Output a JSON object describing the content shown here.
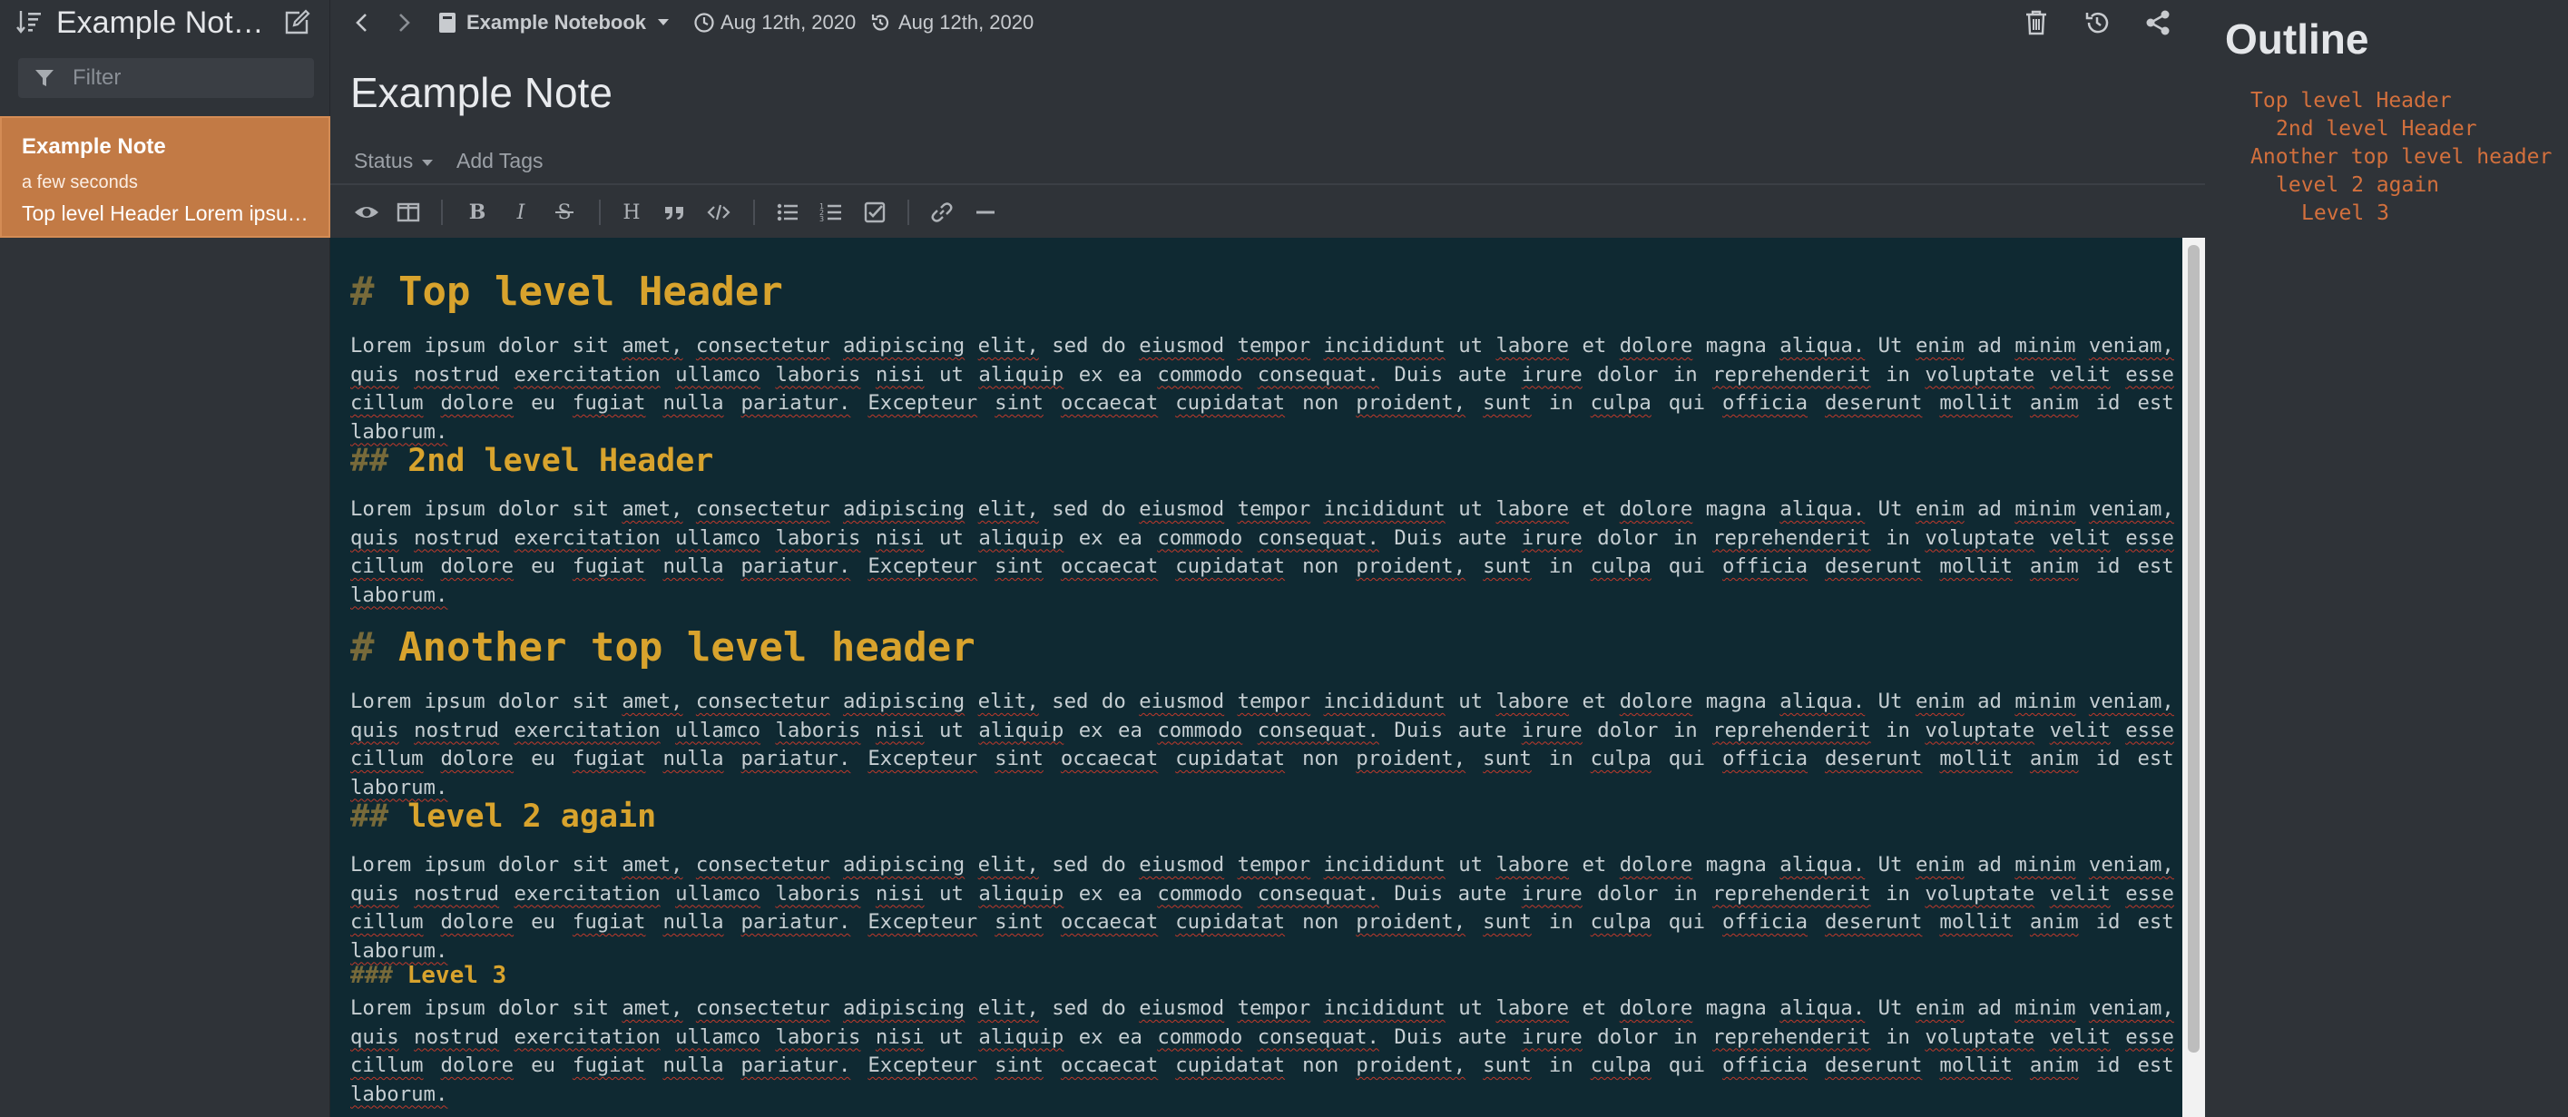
{
  "colors": {
    "background": "#2f3338",
    "editor_bg": "#0f2932",
    "accent_selected": "#c27a45",
    "heading": "#d8a32d",
    "outline_link": "#d3703d"
  },
  "sidebar": {
    "title": "Example Notebook",
    "sort_icon": "sort-icon",
    "new_note_icon": "edit-icon",
    "filter_placeholder": "Filter",
    "notes": [
      {
        "title": "Example Note",
        "time": "a few seconds",
        "preview": "Top level Header Lorem ipsum dolor sit amet"
      }
    ]
  },
  "topbar": {
    "notebook": "Example Notebook",
    "created": "Aug 12th, 2020",
    "modified": "Aug 12th, 2020",
    "icons": [
      "back-icon",
      "forward-icon",
      "notebook-icon",
      "clock-icon",
      "history-icon",
      "trash-icon",
      "restore-icon",
      "share-icon"
    ]
  },
  "note": {
    "title": "Example Note",
    "status_label": "Status",
    "add_tags_label": "Add Tags"
  },
  "toolbar": {
    "buttons": [
      "preview-icon",
      "split-view-icon",
      "bold-icon",
      "italic-icon",
      "strikethrough-icon",
      "heading-icon",
      "quote-icon",
      "code-icon",
      "bullet-list-icon",
      "numbered-list-icon",
      "checklist-icon",
      "link-icon",
      "horizontal-rule-icon"
    ]
  },
  "editor": {
    "blocks": [
      {
        "type": "h1",
        "marker": "#",
        "text": "Top level Header"
      },
      {
        "type": "p",
        "text": "Lorem ipsum dolor sit amet, consectetur adipiscing elit, sed do eiusmod tempor incididunt ut labore et dolore magna aliqua. Ut enim ad minim veniam, quis nostrud exercitation ullamco laboris nisi ut aliquip ex ea commodo consequat. Duis aute irure dolor in reprehenderit in voluptate velit esse cillum dolore eu fugiat nulla pariatur. Excepteur sint occaecat cupidatat non proident, sunt in culpa qui officia deserunt mollit anim id est laborum."
      },
      {
        "type": "h2",
        "marker": "##",
        "text": "2nd level Header"
      },
      {
        "type": "p",
        "text": "Lorem ipsum dolor sit amet, consectetur adipiscing elit, sed do eiusmod tempor incididunt ut labore et dolore magna aliqua. Ut enim ad minim veniam, quis nostrud exercitation ullamco laboris nisi ut aliquip ex ea commodo consequat. Duis aute irure dolor in reprehenderit in voluptate velit esse cillum dolore eu fugiat nulla pariatur. Excepteur sint occaecat cupidatat non proident, sunt in culpa qui officia deserunt mollit anim id est laborum."
      },
      {
        "type": "h1",
        "marker": "#",
        "text": "Another top level header"
      },
      {
        "type": "p",
        "text": "Lorem ipsum dolor sit amet, consectetur adipiscing elit, sed do eiusmod tempor incididunt ut labore et dolore magna aliqua. Ut enim ad minim veniam, quis nostrud exercitation ullamco laboris nisi ut aliquip ex ea commodo consequat. Duis aute irure dolor in reprehenderit in voluptate velit esse cillum dolore eu fugiat nulla pariatur. Excepteur sint occaecat cupidatat non proident, sunt in culpa qui officia deserunt mollit anim id est laborum."
      },
      {
        "type": "h2",
        "marker": "##",
        "text": "level 2 again"
      },
      {
        "type": "p",
        "text": "Lorem ipsum dolor sit amet, consectetur adipiscing elit, sed do eiusmod tempor incididunt ut labore et dolore magna aliqua. Ut enim ad minim veniam, quis nostrud exercitation ullamco laboris nisi ut aliquip ex ea commodo consequat. Duis aute irure dolor in reprehenderit in voluptate velit esse cillum dolore eu fugiat nulla pariatur. Excepteur sint occaecat cupidatat non proident, sunt in culpa qui officia deserunt mollit anim id est laborum."
      },
      {
        "type": "h3",
        "marker": "###",
        "text": "Level 3"
      },
      {
        "type": "p",
        "text": "Lorem ipsum dolor sit amet, consectetur adipiscing elit, sed do eiusmod tempor incididunt ut labore et dolore magna aliqua. Ut enim ad minim veniam, quis nostrud exercitation ullamco laboris nisi ut aliquip ex ea commodo consequat. Duis aute irure dolor in reprehenderit in voluptate velit esse cillum dolore eu fugiat nulla pariatur. Excepteur sint occaecat cupidatat non proident, sunt in culpa qui officia deserunt mollit anim id est laborum."
      }
    ],
    "spellcheck_flagged": [
      "amet,",
      "consectetur",
      "adipiscing",
      "elit,",
      "eiusmod",
      "tempor",
      "incididunt",
      "labore",
      "dolore",
      "aliqua.",
      "enim",
      "minim",
      "veniam,",
      "quis",
      "nostrud",
      "exercitation",
      "ullamco",
      "laboris",
      "nisi",
      "aliquip",
      "commodo",
      "consequat.",
      "irure",
      "reprehenderit",
      "voluptate",
      "velit",
      "esse",
      "cillum",
      "fugiat",
      "nulla",
      "pariatur.",
      "Excepteur",
      "sint",
      "occaecat",
      "cupidatat",
      "proident,",
      "sunt",
      "culpa",
      "officia",
      "deserunt",
      "mollit",
      "anim",
      "laborum."
    ]
  },
  "outline": {
    "title": "Outline",
    "items": [
      {
        "text": "Top level Header",
        "level": 1
      },
      {
        "text": "2nd level Header",
        "level": 2
      },
      {
        "text": "Another top level header",
        "level": 1
      },
      {
        "text": "level 2 again",
        "level": 2
      },
      {
        "text": "Level 3",
        "level": 3
      }
    ]
  }
}
